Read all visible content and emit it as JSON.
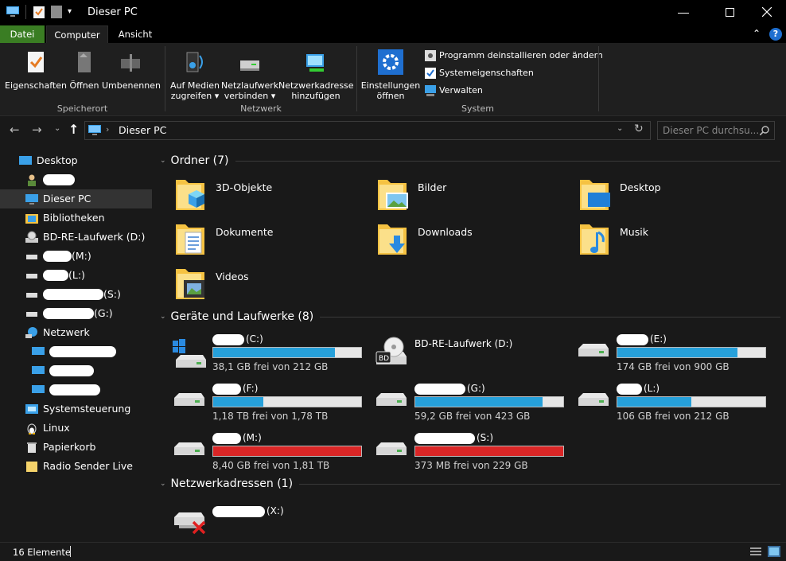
{
  "window": {
    "title": "Dieser PC"
  },
  "tabs": {
    "file": "Datei",
    "computer": "Computer",
    "view": "Ansicht"
  },
  "ribbon": {
    "properties": "Eigenschaften",
    "open": "Öffnen",
    "rename": "Umbenennen",
    "media_l1": "Auf Medien",
    "media_l2": "zugreifen",
    "netdrive_l1": "Netzlaufwerk",
    "netdrive_l2": "verbinden",
    "netaddr_l1": "Netzwerkadresse",
    "netaddr_l2": "hinzufügen",
    "settings_l1": "Einstellungen",
    "settings_l2": "öffnen",
    "uninstall": "Programm deinstallieren oder ändern",
    "sysprops": "Systemeigenschaften",
    "manage": "Verwalten",
    "group_location": "Speicherort",
    "group_network": "Netzwerk",
    "group_system": "System"
  },
  "address": {
    "path": "Dieser PC",
    "search_placeholder": "Dieser PC durchsu..."
  },
  "nav": {
    "desktop": "Desktop",
    "thispc": "Dieser PC",
    "libraries": "Bibliotheken",
    "bdre": "BD-RE-Laufwerk (D:)",
    "drive_m": "(M:)",
    "drive_l": "(L:)",
    "drive_s": "(S:)",
    "drive_g": "(G:)",
    "network": "Netzwerk",
    "control": "Systemsteuerung",
    "linux": "Linux",
    "recycle": "Papierkorb",
    "radio": "Radio Sender Live"
  },
  "sections": {
    "folders": "Ordner (7)",
    "drives": "Geräte und Laufwerke (8)",
    "netaddr": "Netzwerkadressen (1)"
  },
  "folders": [
    {
      "name": "3D-Objekte"
    },
    {
      "name": "Bilder"
    },
    {
      "name": "Desktop"
    },
    {
      "name": "Dokumente"
    },
    {
      "name": "Downloads"
    },
    {
      "name": "Musik"
    },
    {
      "name": "Videos"
    }
  ],
  "drives": [
    {
      "letter": "(C:)",
      "free": "38,1 GB frei von 212 GB",
      "used_pct": 82,
      "color": "#26a0da"
    },
    {
      "letter": "BD-RE-Laufwerk (D:)",
      "free": "",
      "used_pct": 0,
      "color": "#26a0da"
    },
    {
      "letter": "(E:)",
      "free": "174 GB frei von 900 GB",
      "used_pct": 81,
      "color": "#26a0da"
    },
    {
      "letter": "(F:)",
      "free": "1,18 TB frei von 1,78 TB",
      "used_pct": 34,
      "color": "#26a0da"
    },
    {
      "letter": "(G:)",
      "free": "59,2 GB frei von 423 GB",
      "used_pct": 86,
      "color": "#26a0da"
    },
    {
      "letter": "(L:)",
      "free": "106 GB frei von 212 GB",
      "used_pct": 50,
      "color": "#26a0da"
    },
    {
      "letter": "(M:)",
      "free": "8,40 GB frei von 1,81 TB",
      "used_pct": 100,
      "color": "#da2626"
    },
    {
      "letter": "(S:)",
      "free": "373 MB frei von 229 GB",
      "used_pct": 100,
      "color": "#da2626"
    }
  ],
  "netdrive": {
    "letter": "(X:)"
  },
  "status": {
    "count": "16 Elemente"
  }
}
